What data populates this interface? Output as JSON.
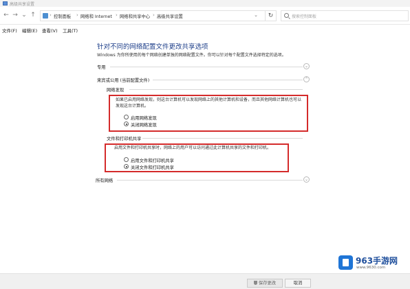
{
  "window": {
    "title": "高级共享设置"
  },
  "nav": {
    "back": "←",
    "forward": "→",
    "up": "↑",
    "recent": "⌄",
    "refresh": "↻"
  },
  "breadcrumb": {
    "items": [
      "控制面板",
      "网络和 Internet",
      "网络和共享中心",
      "高级共享设置"
    ],
    "separator": "›",
    "dropdown": "⌄"
  },
  "search": {
    "placeholder": "搜索控制面板"
  },
  "menu": [
    "文件(F)",
    "编辑(E)",
    "查看(V)",
    "工具(T)"
  ],
  "main": {
    "heading": "针对不同的网络配置文件更改共享选项",
    "description": "Windows 为你所使用的每个网络创建单独的网络配置文件。你可以针对每个配置文件选择特定的选项。",
    "profiles": {
      "private": "专用",
      "guest_public": "来宾或公用 (当前配置文件)",
      "all": "所有网络"
    },
    "network_discovery": {
      "title": "网络发现",
      "text": "如果已启用网络发现，则这台计算机可以发现网络上的其他计算机和设备，而且其他网络计算机也可以发现这台计算机。",
      "options": [
        "启用网络发现",
        "关闭网络发现"
      ],
      "selected": 1
    },
    "file_printer_sharing": {
      "title": "文件和打印机共享",
      "text": "启用文件和打印机共享时，网络上的用户可以访问通过此计算机共享的文件和打印机。",
      "options": [
        "启用文件和打印机共享",
        "关闭文件和打印机共享"
      ],
      "selected": 1
    },
    "chevron": "⌄"
  },
  "footer": {
    "save_label": "保存更改",
    "cancel_label": "取消"
  },
  "watermark": {
    "brand": "963手游网",
    "url": "www.9630.com"
  },
  "colors": {
    "heading": "#1e3f8a",
    "highlight_box": "#d42a2a",
    "watermark_blue": "#1f75d6"
  }
}
